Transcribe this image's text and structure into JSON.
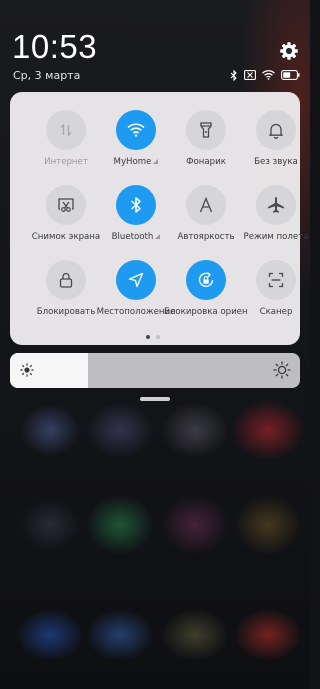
{
  "status_bar": {
    "time": "10:53",
    "date": "Ср, 3 марта",
    "icons": [
      "bluetooth-icon",
      "no-sim-icon",
      "wifi-icon",
      "battery-icon"
    ]
  },
  "settings_icon": "gear-icon",
  "tiles": [
    {
      "label": "Интернет",
      "icon": "mobile-data-icon",
      "active": false,
      "dim": true
    },
    {
      "label": "MyHome",
      "icon": "wifi-icon",
      "active": true,
      "expand": true
    },
    {
      "label": "Фонарик",
      "icon": "flashlight-icon",
      "active": false
    },
    {
      "label": "Без звука",
      "icon": "bell-icon",
      "active": false
    },
    {
      "label": "Снимок экрана",
      "icon": "screenshot-icon",
      "active": false
    },
    {
      "label": "Bluetooth",
      "icon": "bluetooth-icon",
      "active": true,
      "expand": true
    },
    {
      "label": "Автояркость",
      "icon": "auto-brightness-icon",
      "active": false
    },
    {
      "label": "Режим полета",
      "icon": "airplane-icon",
      "active": false
    },
    {
      "label": "Блокировать",
      "icon": "lock-icon",
      "active": false
    },
    {
      "label": "Местоположение",
      "icon": "location-icon",
      "active": true
    },
    {
      "label": "Блокировка ориентации",
      "icon": "rotation-lock-icon",
      "active": true
    },
    {
      "label": "Сканер",
      "icon": "scanner-icon",
      "active": false
    }
  ],
  "pager": {
    "pages": 2,
    "current": 1
  },
  "brightness": {
    "level": 0.27
  },
  "colors": {
    "accent": "#1e9bf0",
    "tile_off": "#d6d5d8",
    "panel": "#f0eef0"
  }
}
